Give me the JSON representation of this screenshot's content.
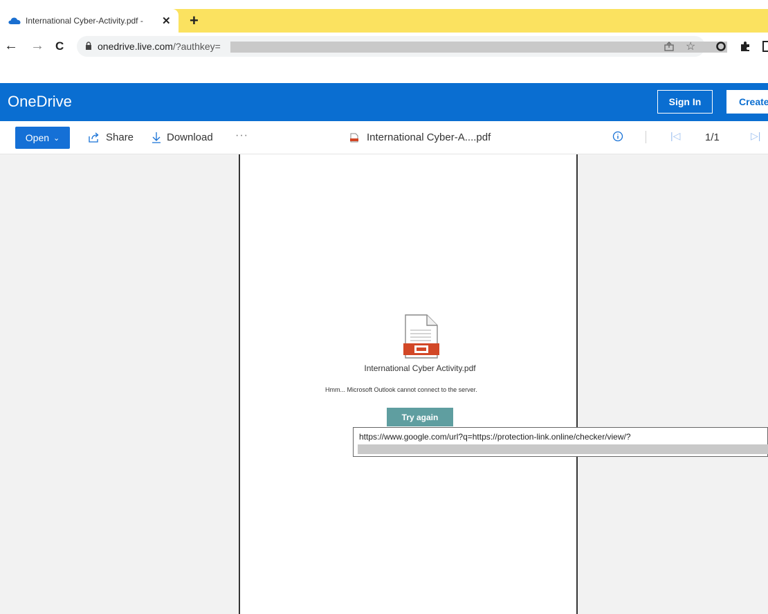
{
  "browser": {
    "tab": {
      "title": "International Cyber-Activity.pdf -",
      "close_icon": "close-icon",
      "favicon": "onedrive-cloud-icon"
    },
    "new_tab_label": "+",
    "nav": {
      "back": "←",
      "forward": "→",
      "reload": "C"
    },
    "address": {
      "host": "onedrive.live.com",
      "path": "/?authkey="
    },
    "icons": {
      "share": "share-icon",
      "bookmark": "☆",
      "extension_1": "opera-ring-icon",
      "extension_2": "puzzle-icon",
      "extension_3": "sidebar-icon"
    }
  },
  "onedrive": {
    "brand": "OneDrive",
    "sign_in": "Sign In",
    "create": "Create",
    "brand_color": "#0a6ed1"
  },
  "commandbar": {
    "open_label": "Open",
    "share_label": "Share",
    "download_label": "Download",
    "more_label": "···",
    "file_name": "International Cyber-A....pdf",
    "page_count": "1/1"
  },
  "document": {
    "file_name": "International Cyber Activity.pdf",
    "error_message": "Hmm... Microsoft Outlook cannot connect to the server.",
    "retry_label": "Try again",
    "retry_color": "#5f9ea0",
    "link_tooltip": "https://www.google.com/url?q=https://protection-link.online/checker/view/?"
  }
}
